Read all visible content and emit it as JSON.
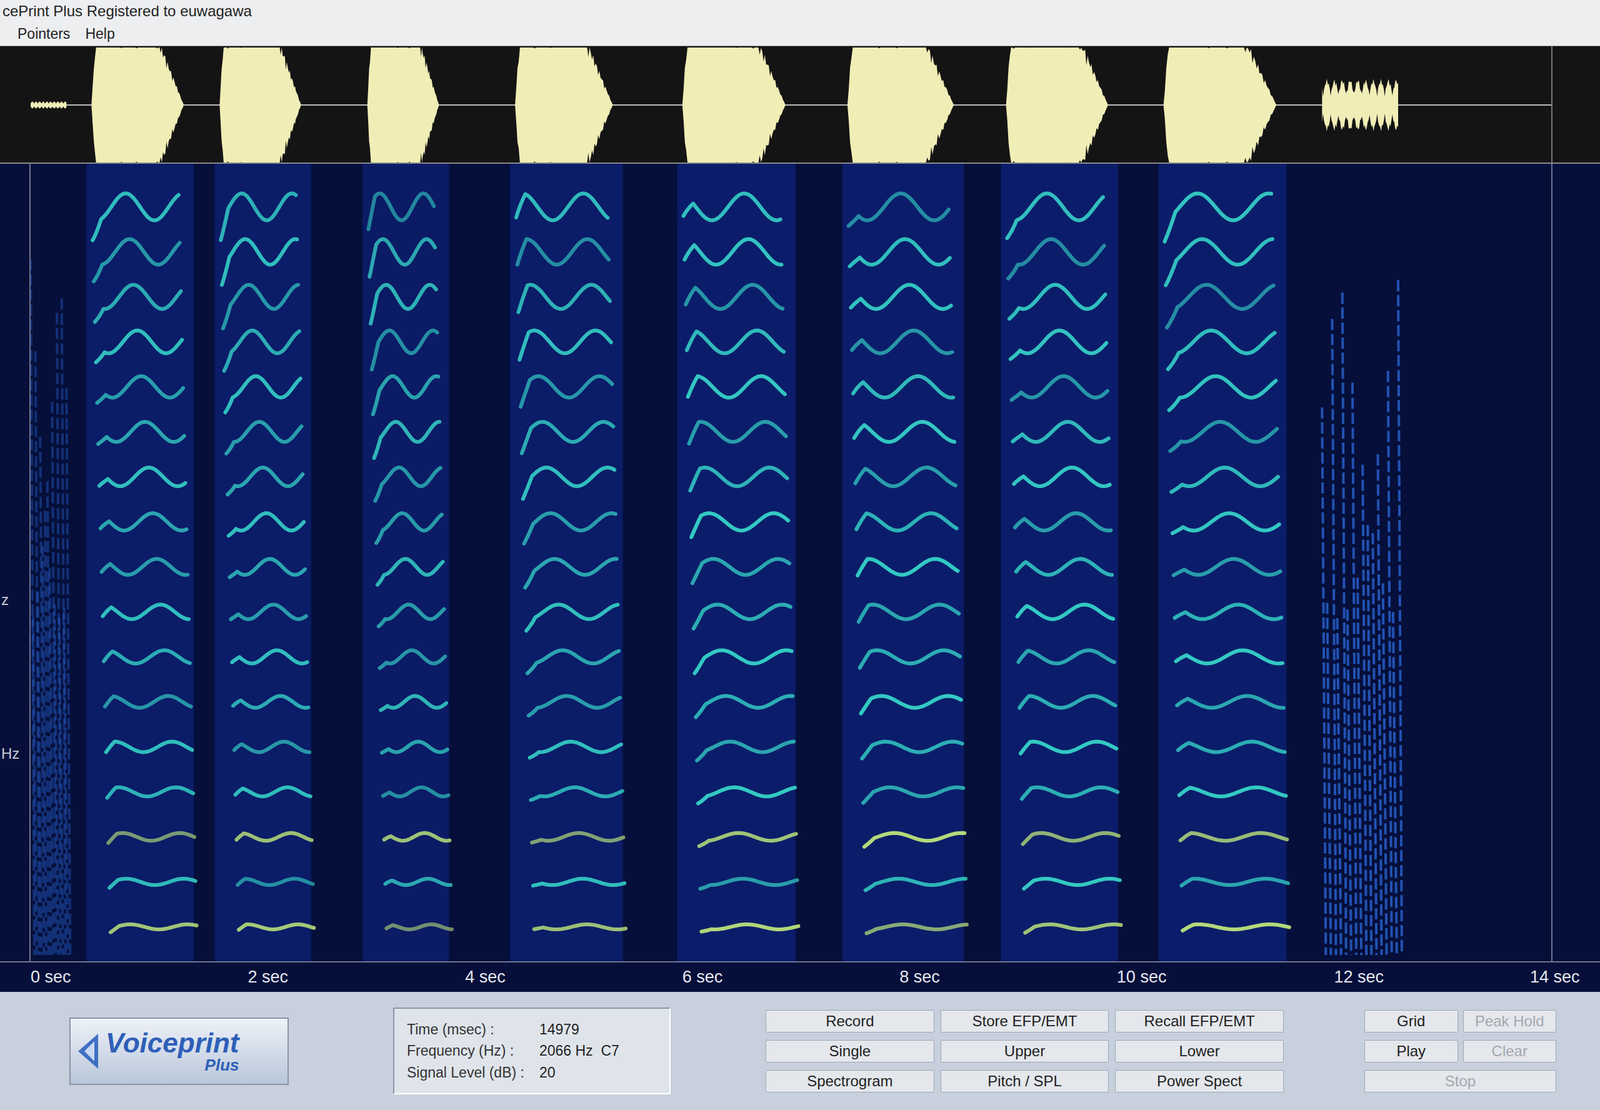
{
  "window": {
    "title": "cePrint Plus Registered to euwagawa"
  },
  "menu": [
    {
      "label": "Pointers"
    },
    {
      "label": "Help"
    }
  ],
  "spectrogram": {
    "y_axis_labels": [
      "z",
      "Hz"
    ],
    "x_axis_labels": [
      "0 sec",
      "2 sec",
      "4 sec",
      "6 sec",
      "8 sec",
      "10 sec",
      "12 sec",
      "14 sec"
    ],
    "x_max_sec": 14,
    "harmonics": 17,
    "syllables": [
      {
        "kind": "noise",
        "start": 0.0,
        "end": 0.33,
        "amplitude": 0.05,
        "intensity": 0.35
      },
      {
        "kind": "tonal",
        "start": 0.56,
        "end": 1.41,
        "amplitude": 1.0,
        "intensity": 0.85
      },
      {
        "kind": "tonal",
        "start": 1.74,
        "end": 2.49,
        "amplitude": 1.0,
        "intensity": 0.85
      },
      {
        "kind": "tonal",
        "start": 3.1,
        "end": 3.76,
        "amplitude": 1.0,
        "intensity": 0.8
      },
      {
        "kind": "tonal",
        "start": 4.46,
        "end": 5.36,
        "amplitude": 1.0,
        "intensity": 0.85
      },
      {
        "kind": "tonal",
        "start": 6.0,
        "end": 6.95,
        "amplitude": 1.0,
        "intensity": 0.9
      },
      {
        "kind": "tonal",
        "start": 7.52,
        "end": 8.5,
        "amplitude": 1.0,
        "intensity": 0.9
      },
      {
        "kind": "tonal",
        "start": 8.98,
        "end": 9.92,
        "amplitude": 1.0,
        "intensity": 0.9
      },
      {
        "kind": "tonal",
        "start": 10.43,
        "end": 11.47,
        "amplitude": 1.0,
        "intensity": 0.9
      },
      {
        "kind": "noise",
        "start": 11.89,
        "end": 12.59,
        "amplitude": 0.35,
        "intensity": 0.7
      }
    ]
  },
  "logo": {
    "name": "Voiceprint",
    "suffix": "Plus"
  },
  "readout": [
    {
      "label": "Time (msec) :",
      "value": "14979"
    },
    {
      "label": "Frequency (Hz) :",
      "value": "2066 Hz  C7"
    },
    {
      "label": "Signal Level (dB) :",
      "value": "20"
    }
  ],
  "buttons": [
    {
      "label": "Record",
      "disabled": false
    },
    {
      "label": "Store EFP/EMT",
      "disabled": false
    },
    {
      "label": "Recall EFP/EMT",
      "disabled": false
    },
    {
      "label": "Single",
      "disabled": false
    },
    {
      "label": "Upper",
      "disabled": false
    },
    {
      "label": "Lower",
      "disabled": false
    },
    {
      "label": "Spectrogram",
      "disabled": false
    },
    {
      "label": "Pitch / SPL",
      "disabled": false
    },
    {
      "label": "Power Spect",
      "disabled": false
    }
  ],
  "side_buttons": [
    {
      "label": "Grid",
      "disabled": false
    },
    {
      "label": "Peak Hold",
      "disabled": true
    },
    {
      "label": "Play",
      "disabled": false
    },
    {
      "label": "Clear",
      "disabled": true
    },
    {
      "label": "Stop",
      "disabled": true
    }
  ]
}
